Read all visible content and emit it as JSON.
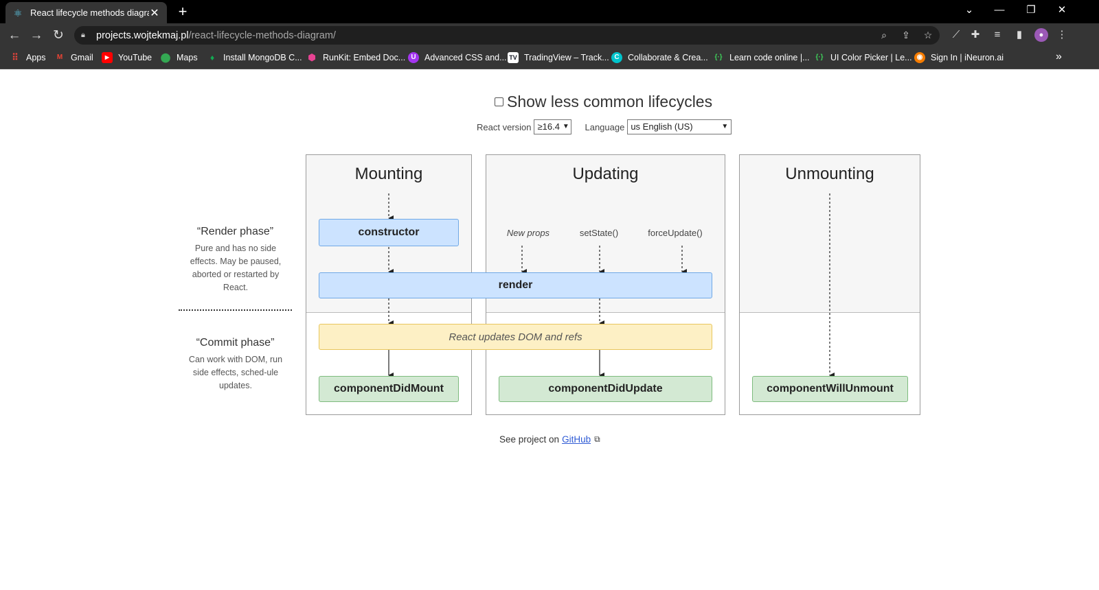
{
  "browser": {
    "tab_title": "React lifecycle methods diagram",
    "url_host": "projects.wojtekmaj.pl",
    "url_path": "/react-lifecycle-methods-diagram/",
    "bookmarks": [
      {
        "label": "Apps",
        "icon": "apps-grid-icon",
        "color": "#e8453c"
      },
      {
        "label": "Gmail",
        "icon": "gmail-icon",
        "color": "#ea4335"
      },
      {
        "label": "YouTube",
        "icon": "youtube-icon",
        "color": "#ff0000"
      },
      {
        "label": "Maps",
        "icon": "maps-icon",
        "color": "#34a853"
      },
      {
        "label": "Install MongoDB C...",
        "icon": "mongodb-icon",
        "color": "#13aa52"
      },
      {
        "label": "RunKit: Embed Doc...",
        "icon": "runkit-icon",
        "color": "#e84393"
      },
      {
        "label": "Advanced CSS and...",
        "icon": "udemy-icon",
        "color": "#a435f0"
      },
      {
        "label": "TradingView – Track...",
        "icon": "tradingview-icon",
        "color": "#131722"
      },
      {
        "label": "Collaborate & Crea...",
        "icon": "canva-icon",
        "color": "#00c4cc"
      },
      {
        "label": "Learn code online |...",
        "icon": "scrimba-icon",
        "color": "#2d8f3a"
      },
      {
        "label": "UI Color Picker | Le...",
        "icon": "scrimba-icon",
        "color": "#2d8f3a"
      },
      {
        "label": "Sign In | iNeuron.ai",
        "icon": "ineuron-icon",
        "color": "#f57c00"
      }
    ]
  },
  "page": {
    "show_less_label": "Show less common lifecycles",
    "react_version_label": "React version",
    "react_version_value": "≥16.4",
    "language_label": "Language",
    "language_value": "us English (US)",
    "render_phase_title": "“Render phase”",
    "render_phase_desc": "Pure and has no side effects. May be paused, aborted or restarted by React.",
    "commit_phase_title": "“Commit phase”",
    "commit_phase_desc": "Can work with DOM, run side effects, sched-ule updates.",
    "columns": {
      "mounting": "Mounting",
      "updating": "Updating",
      "unmounting": "Unmounting"
    },
    "triggers": {
      "new_props": "New props",
      "set_state": "setState()",
      "force_update": "forceUpdate()"
    },
    "methods": {
      "constructor": "constructor",
      "render": "render",
      "dom_update": "React updates DOM and refs",
      "did_mount": "componentDidMount",
      "did_update": "componentDidUpdate",
      "will_unmount": "componentWillUnmount"
    },
    "footer_text": "See project on",
    "footer_link": "GitHub",
    "colors": {
      "blue_box": "#cce3ff",
      "green_box": "#d3e9d3",
      "yellow_box": "#fdf0c5"
    }
  }
}
